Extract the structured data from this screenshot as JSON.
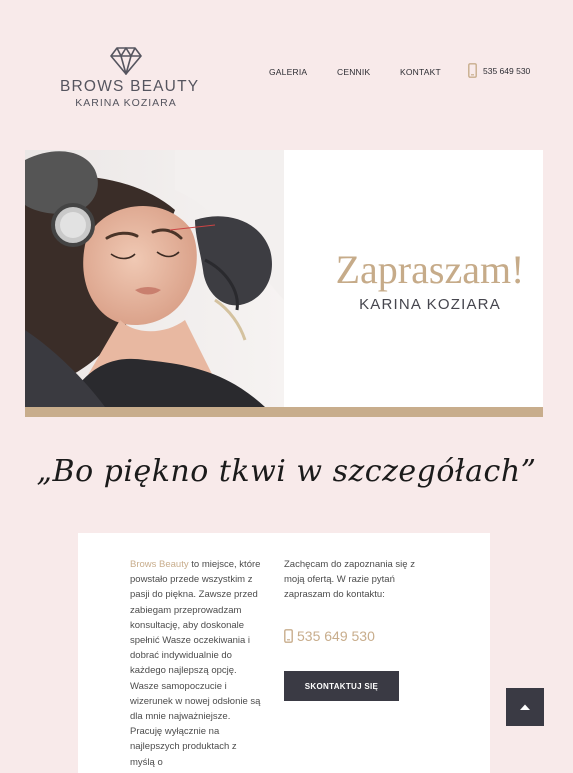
{
  "header": {
    "logo_title": "BROWS BEAUTY",
    "logo_subtitle": "KARINA KOZIARA",
    "logo_icon": "diamond-icon",
    "nav": [
      {
        "label": "GALERIA"
      },
      {
        "label": "CENNIK"
      },
      {
        "label": "KONTAKT"
      }
    ],
    "phone_icon": "phone-icon",
    "phone": "535 649 530"
  },
  "hero": {
    "title": "Zapraszam!",
    "subtitle": "KARINA KOZIARA"
  },
  "quote": "„Bo piękno tkwi w szczegółach”",
  "about": {
    "brand_link": "Brows Beauty",
    "left_text": " to miejsce, które powstało przede wszystkim z pasji do piękna. Zawsze przed zabiegam przeprowadzam konsultację, aby doskonale spełnić Wasze oczekiwania i dobrać indywidualnie do każdego najlepszą opcję. Wasze samopoczucie i wizerunek w nowej odsłonie są dla mnie najważniejsze. Pracuję wyłącznie na najlepszych produktach z myślą o",
    "right_text": "Zachęcam do zapoznania się z moją ofertą. W razie pytań zapraszam do kontaktu:",
    "phone": "535 649 530",
    "button_label": "SKONTAKTUJ SIĘ"
  },
  "scroll_top_icon": "arrow-up-icon",
  "colors": {
    "background": "#f8eaea",
    "accent": "#c8ad8c",
    "dark": "#3a3a44"
  }
}
